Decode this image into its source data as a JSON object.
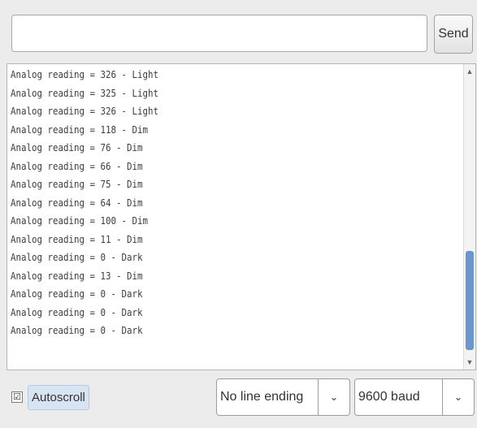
{
  "input": {
    "value": ""
  },
  "send_button": {
    "label": "Send"
  },
  "output": {
    "lines": [
      "Analog reading = 326 - Light",
      "Analog reading = 325 - Light",
      "Analog reading = 326 - Light",
      "Analog reading = 118 - Dim",
      "Analog reading = 76 - Dim",
      "Analog reading = 66 - Dim",
      "Analog reading = 75 - Dim",
      "Analog reading = 64 - Dim",
      "Analog reading = 100 - Dim",
      "Analog reading = 11 - Dim",
      "Analog reading = 0 - Dark",
      "Analog reading = 13 - Dim",
      "Analog reading = 0 - Dark",
      "Analog reading = 0 - Dark",
      "Analog reading = 0 - Dark"
    ]
  },
  "footer": {
    "autoscroll": {
      "label": "Autoscroll",
      "checked": true,
      "check_glyph": "☑"
    },
    "line_ending": {
      "selected": "No line ending",
      "chevron": "⌄"
    },
    "baud": {
      "selected": "9600 baud",
      "chevron": "⌄"
    }
  },
  "scrollbar": {
    "up_glyph": "▲",
    "down_glyph": "▼"
  },
  "colors": {
    "scroll_thumb": "#6b98cc",
    "autoscroll_highlight": "#d7e4f2"
  }
}
